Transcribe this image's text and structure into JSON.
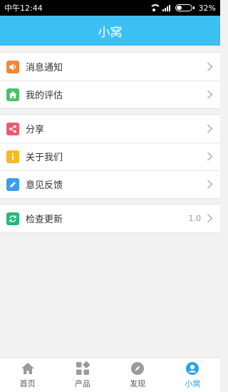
{
  "status_bar": {
    "time": "中午12:44",
    "battery": "32%"
  },
  "header": {
    "title": "小窝"
  },
  "groups": [
    {
      "items": [
        {
          "label": "消息通知",
          "icon": "speaker-icon",
          "color": "#f0883a"
        },
        {
          "label": "我的评估",
          "icon": "home-icon",
          "color": "#4cc267"
        }
      ]
    },
    {
      "items": [
        {
          "label": "分享",
          "icon": "share-icon",
          "color": "#ef5a6f"
        },
        {
          "label": "关于我们",
          "icon": "info-icon",
          "color": "#f8bb1e"
        },
        {
          "label": "意见反馈",
          "icon": "pencil-icon",
          "color": "#3a9ef0"
        }
      ]
    },
    {
      "items": [
        {
          "label": "检查更新",
          "value": "1.0",
          "icon": "refresh-icon",
          "color": "#26b97a"
        }
      ]
    }
  ],
  "tabbar": {
    "tabs": [
      {
        "label": "首页",
        "icon": "home-icon"
      },
      {
        "label": "产品",
        "icon": "grid-icon"
      },
      {
        "label": "发现",
        "icon": "compass-icon"
      },
      {
        "label": "小窝",
        "icon": "user-icon",
        "active": true
      }
    ],
    "active_color": "#2aa3e8"
  }
}
